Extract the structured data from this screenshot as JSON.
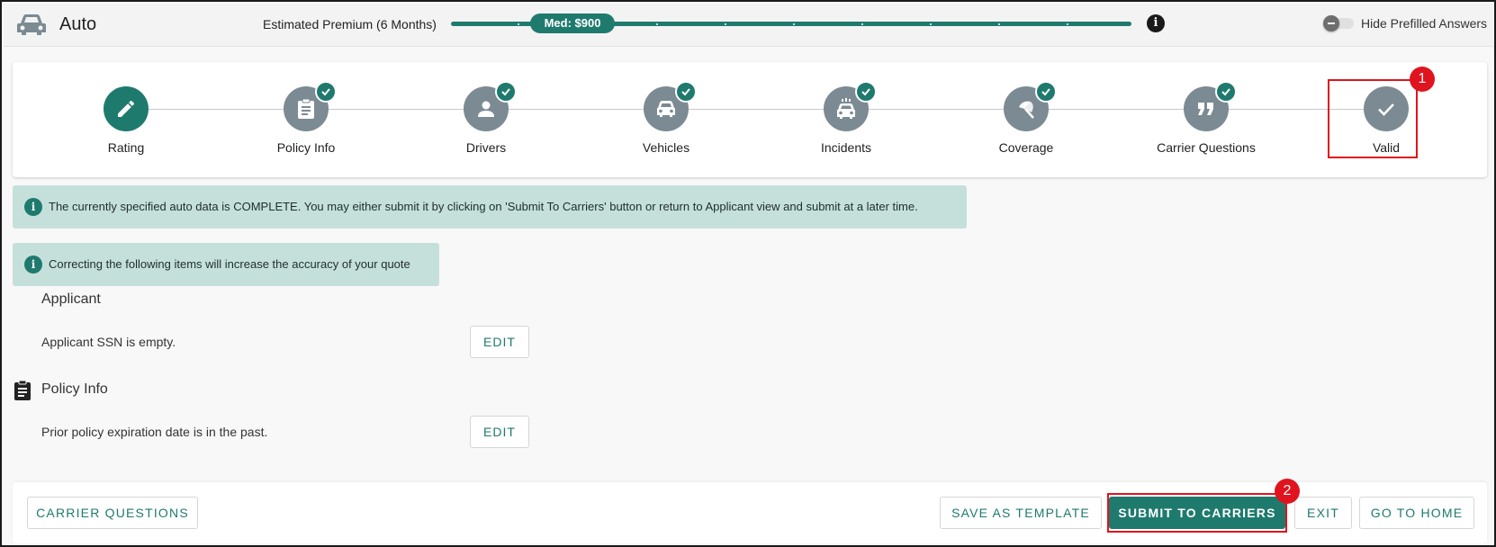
{
  "header": {
    "title": "Auto",
    "premium_label": "Estimated Premium (6 Months)",
    "premium_pill": "Med: $900",
    "info_icon": "i",
    "toggle_label": "Hide Prefilled Answers",
    "toggle_on": false
  },
  "stepper": {
    "steps": [
      {
        "label": "Rating",
        "icon": "pencil-icon",
        "state": "active"
      },
      {
        "label": "Policy Info",
        "icon": "clipboard-icon",
        "state": "complete"
      },
      {
        "label": "Drivers",
        "icon": "person-icon",
        "state": "complete"
      },
      {
        "label": "Vehicles",
        "icon": "car-icon",
        "state": "complete"
      },
      {
        "label": "Incidents",
        "icon": "car-crash-icon",
        "state": "complete"
      },
      {
        "label": "Coverage",
        "icon": "umbrella-icon",
        "state": "complete"
      },
      {
        "label": "Carrier Questions",
        "icon": "quote-icon",
        "state": "complete"
      },
      {
        "label": "Valid",
        "icon": "check-icon",
        "state": "current"
      }
    ],
    "annotation_badge": "1"
  },
  "alerts": {
    "complete": "The currently specified auto data is COMPLETE. You may either submit it by clicking on 'Submit To Carriers' button or return to Applicant view and submit at a later time.",
    "accuracy": "Correcting the following items will increase the accuracy of your quote"
  },
  "sections": {
    "applicant": {
      "title": "Applicant",
      "item": "Applicant SSN is empty.",
      "edit_label": "EDIT"
    },
    "policy_info": {
      "title": "Policy Info",
      "item": "Prior policy expiration date is in the past.",
      "edit_label": "EDIT"
    }
  },
  "footer": {
    "carrier_questions": "CARRIER QUESTIONS",
    "save_template": "SAVE AS TEMPLATE",
    "submit": "SUBMIT TO CARRIERS",
    "exit": "EXIT",
    "go_home": "GO TO HOME",
    "annotation_badge": "2"
  },
  "colors": {
    "accent": "#1f7a6e",
    "step_inactive": "#7b8a93",
    "alert_bg": "#c5e0db",
    "highlight": "#e0141e"
  }
}
